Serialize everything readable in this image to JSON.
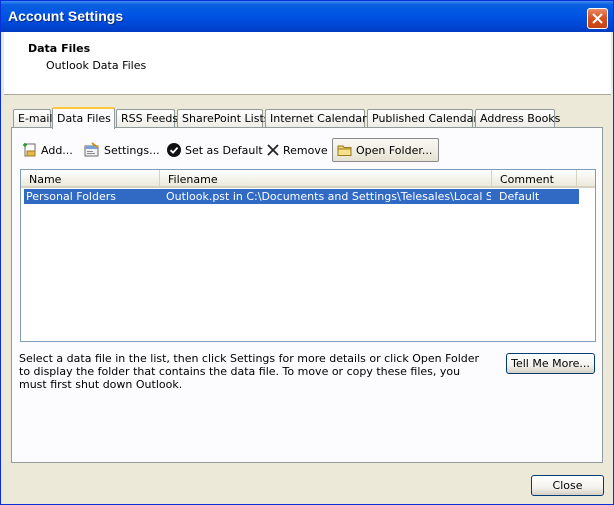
{
  "window": {
    "title": "Account Settings"
  },
  "header": {
    "title": "Data Files",
    "subtitle": "Outlook Data Files"
  },
  "tabs": [
    {
      "label": "E-mail"
    },
    {
      "label": "Data Files",
      "active": true
    },
    {
      "label": "RSS Feeds"
    },
    {
      "label": "SharePoint Lists"
    },
    {
      "label": "Internet Calendars"
    },
    {
      "label": "Published Calendars"
    },
    {
      "label": "Address Books"
    }
  ],
  "toolbar": {
    "add_label": "Add...",
    "settings_label": "Settings...",
    "set_default_label": "Set as Default",
    "remove_label": "Remove",
    "open_folder_label": "Open Folder..."
  },
  "list": {
    "columns": [
      "Name",
      "Filename",
      "Comment"
    ],
    "rows": [
      {
        "name": "Personal Folders",
        "filename": "Outlook.pst in C:\\Documents and Settings\\Telesales\\Local Settin...",
        "comment": "Default",
        "selected": true
      }
    ]
  },
  "info_text": "Select a data file in the list, then click Settings for more details or click Open Folder to display the folder that contains the data file. To move or copy these files, you must first shut down Outlook.",
  "buttons": {
    "tell_me_more": "Tell Me More...",
    "close": "Close"
  },
  "colors": {
    "titlebar": "#0055e5",
    "selection": "#316ac5",
    "active_tab_accent": "#ffc83c"
  }
}
